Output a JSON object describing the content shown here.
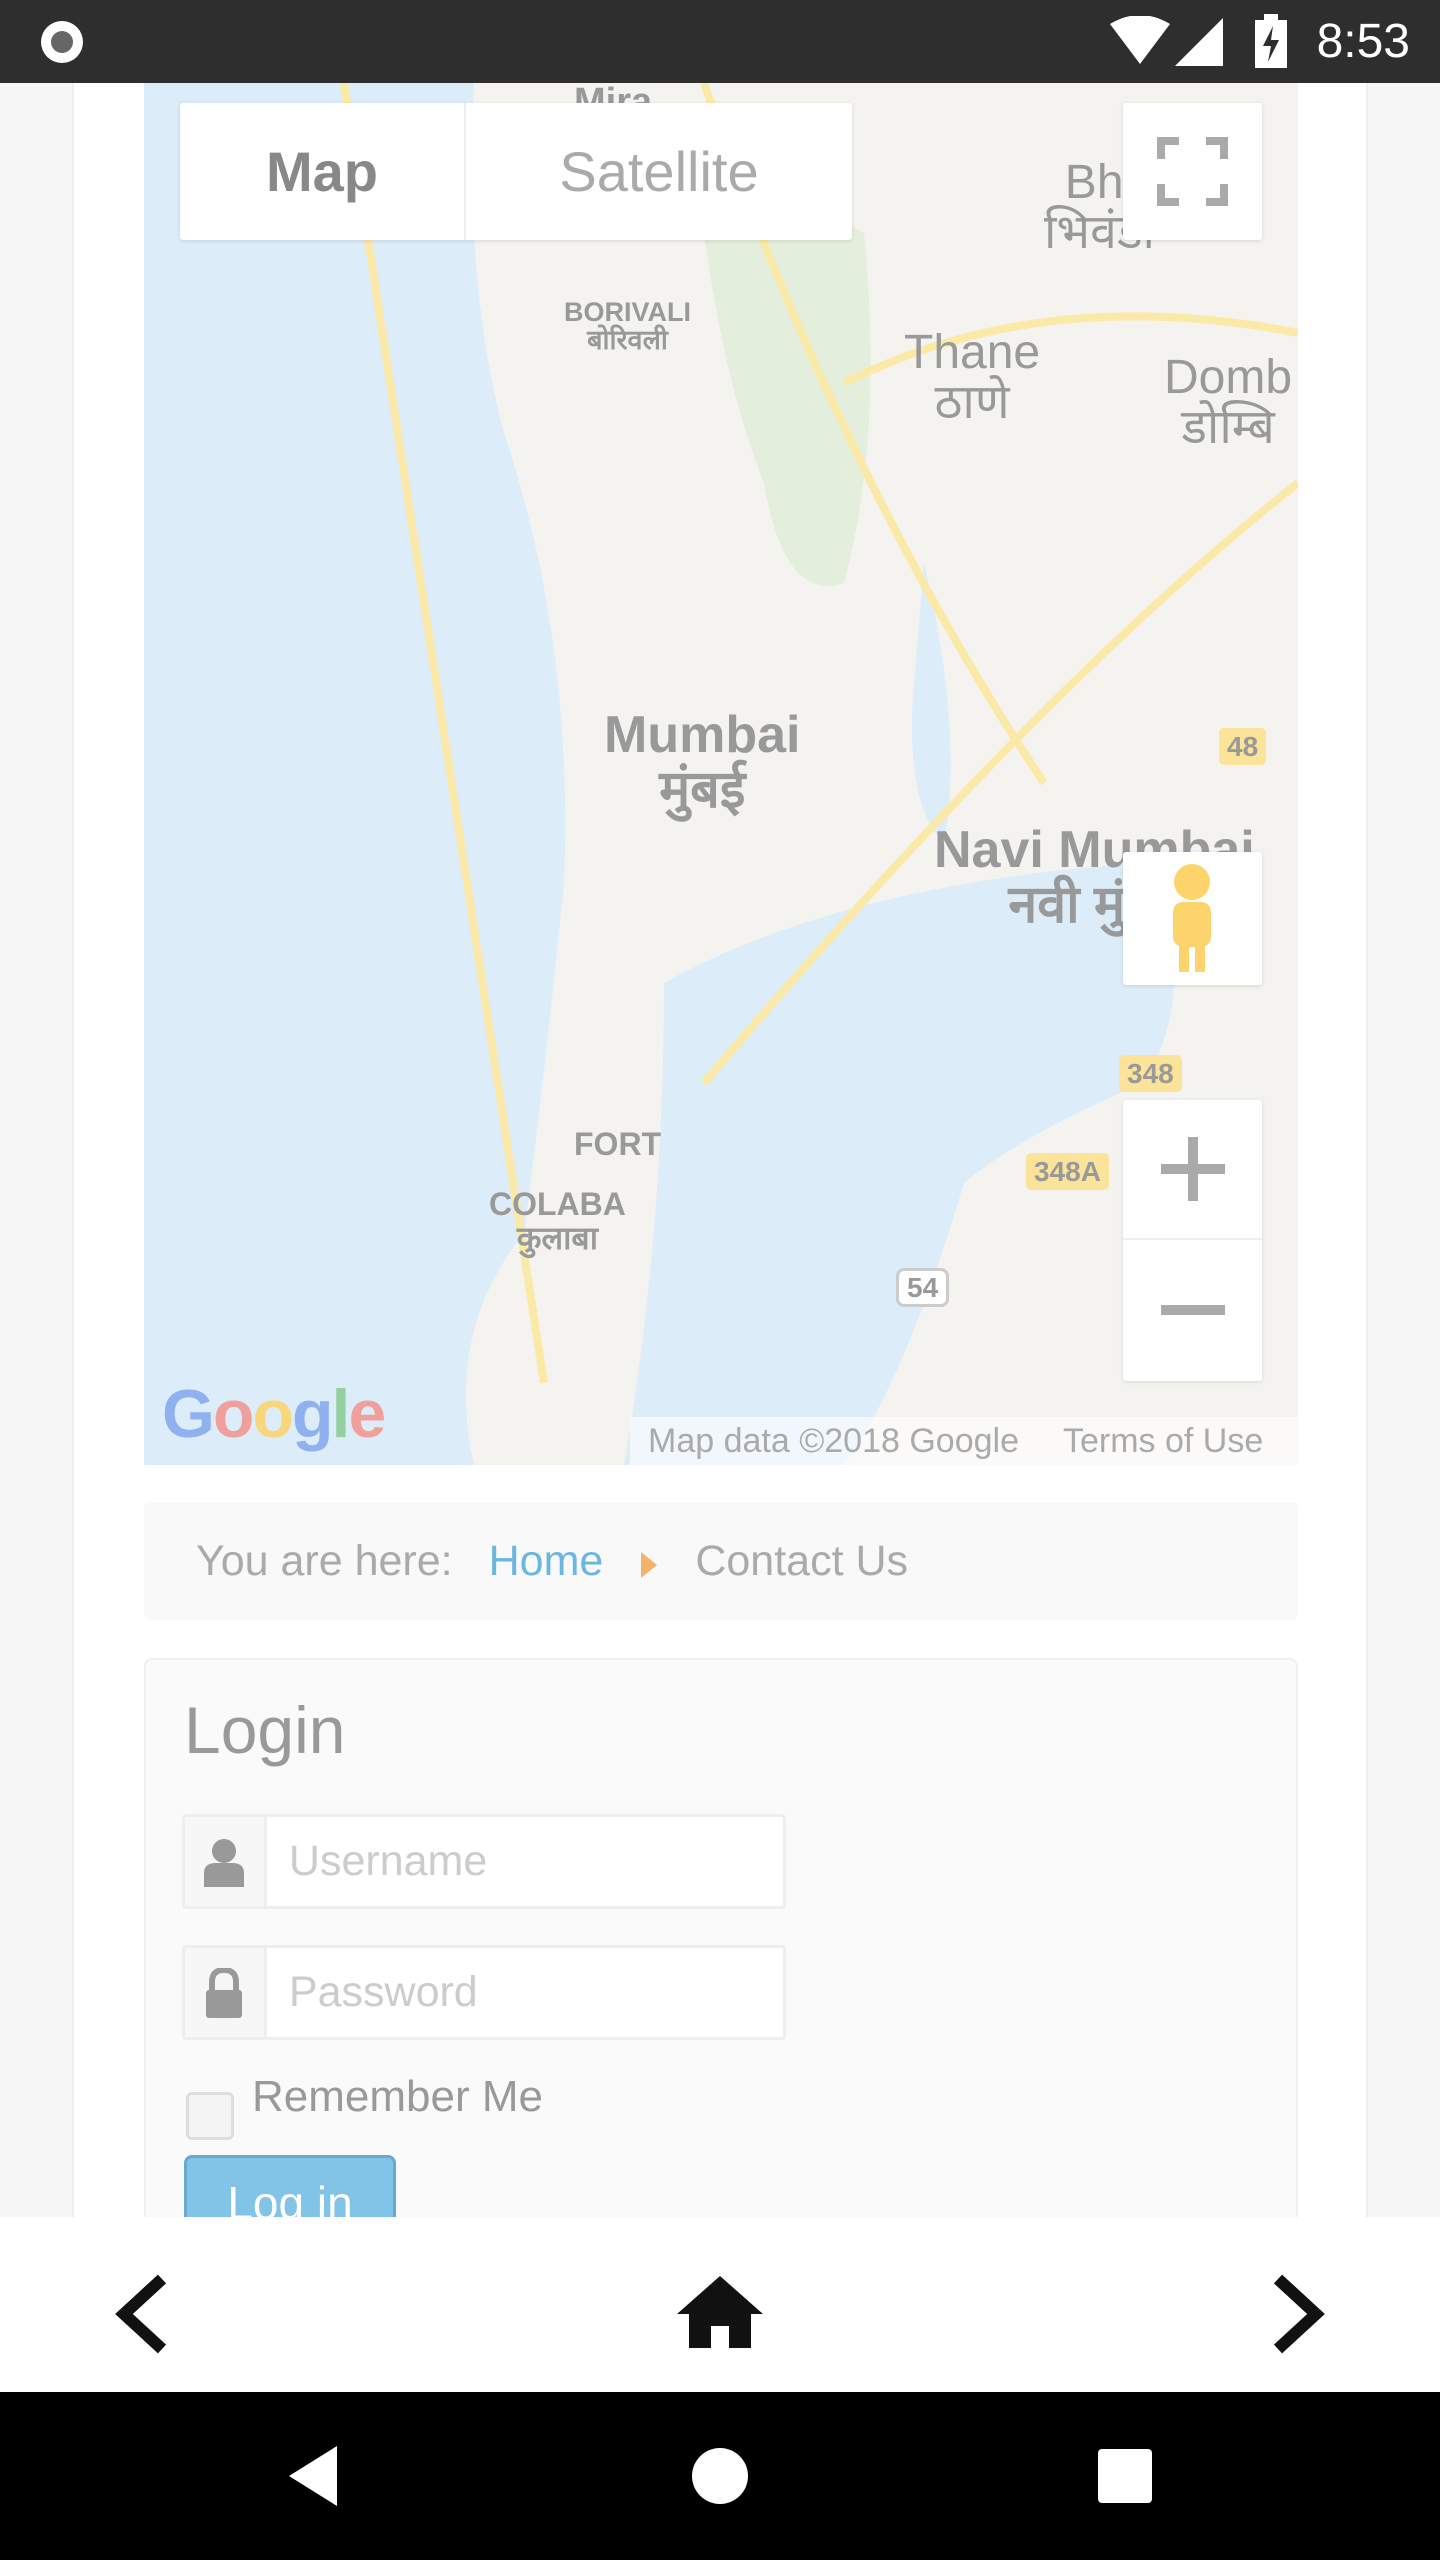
{
  "status_bar": {
    "time": "8:53"
  },
  "map": {
    "type_controls": {
      "map": "Map",
      "satellite": "Satellite",
      "selected": "Map"
    },
    "labels": [
      {
        "name": "mira",
        "text": "Mira\nमीरा"
      },
      {
        "name": "borivali",
        "text": "BORIVALI\nबोरिवली"
      },
      {
        "name": "thane",
        "text": "Thane\nठाणे"
      },
      {
        "name": "bhiwandi",
        "text": "Bhi\nभिवंडी"
      },
      {
        "name": "dombivli",
        "text": "Domb\nडोम्बि"
      },
      {
        "name": "mumbai",
        "text": "Mumbai\nमुंबई"
      },
      {
        "name": "navi-mumbai",
        "text": "Navi Mumbai\nनवी मुंबई"
      },
      {
        "name": "fort",
        "text": "FORT"
      },
      {
        "name": "colaba",
        "text": "COLABA\nकुलाबा"
      }
    ],
    "shields": [
      "48",
      "48",
      "348",
      "348A",
      "54"
    ],
    "logo": "Google",
    "attribution": "Map data ©2018 Google",
    "terms": "Terms of Use"
  },
  "breadcrumb": {
    "prefix": "You are here:",
    "home": "Home",
    "current": "Contact Us",
    "link_color": "#6ab7e0",
    "separator_color": "#f5b26b"
  },
  "login": {
    "title": "Login",
    "username_placeholder": "Username",
    "password_placeholder": "Password",
    "remember": "Remember Me",
    "remember_checked": false,
    "submit": "Log in",
    "button_color": "#82c4e8"
  }
}
